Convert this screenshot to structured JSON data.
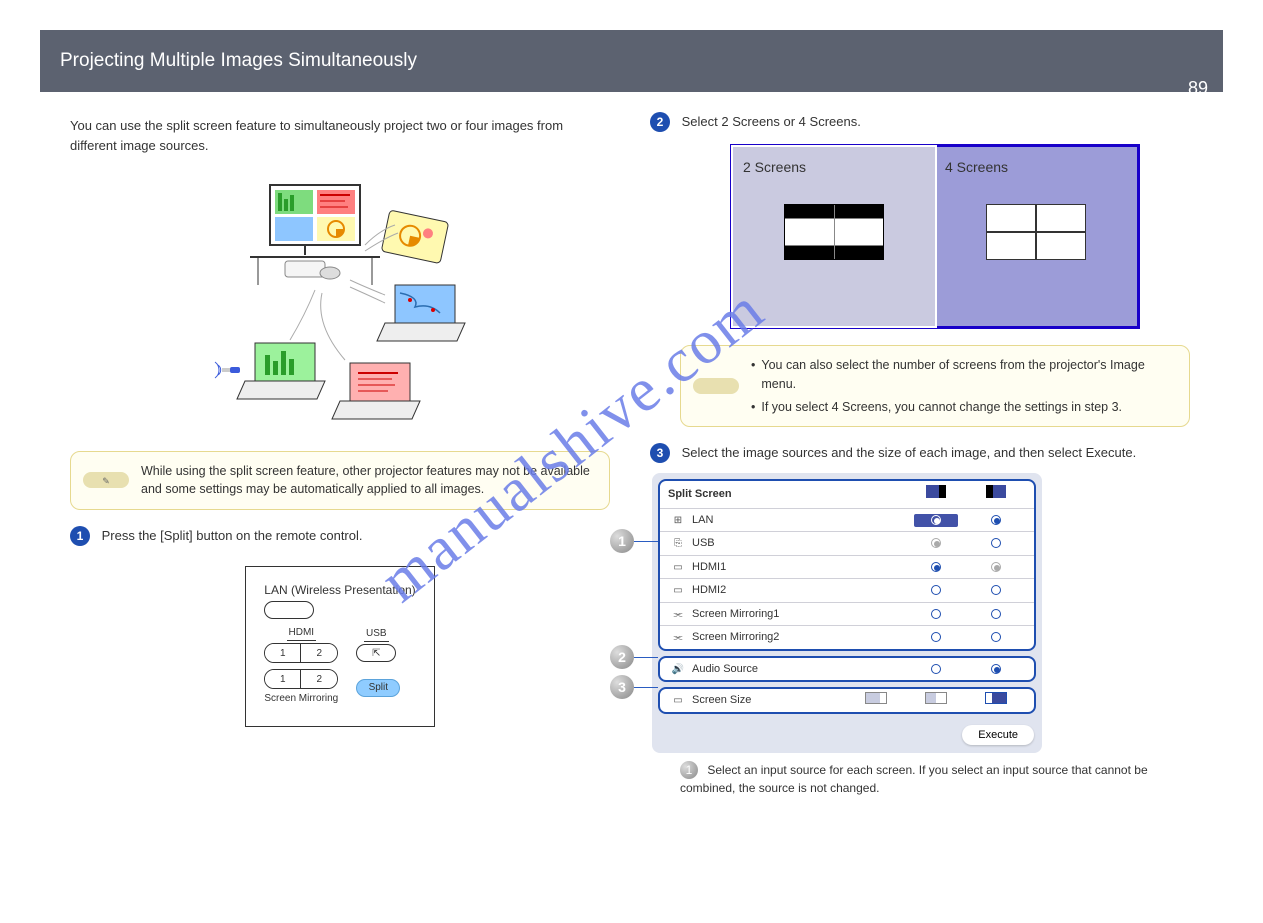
{
  "header": {
    "title": "Projecting Multiple Images Simultaneously",
    "page": "89"
  },
  "left": {
    "intro": "You can use the split screen feature to simultaneously project two or four images from different image sources.",
    "note_text": "While using the split screen feature, other projector features may not be available and some settings may be automatically applied to all images.",
    "step1": "Press the [Split] button on the remote control.",
    "remote": {
      "lan": "LAN (Wireless Presentation)",
      "hdmi": "HDMI",
      "usb": "USB",
      "b1": "1",
      "b2": "2",
      "sm": "Screen Mirroring",
      "split": "Split"
    }
  },
  "right": {
    "step2": "Select 2 Screens or 4 Screens.",
    "opt2": "2 Screens",
    "opt4": "4 Screens",
    "note2a": "You can also select the number of screens from the projector's Image menu.",
    "note2b": "If you select 4 Screens, you cannot change the settings in step 3.",
    "step3": "Select the image sources and the size of each image, and then select Execute.",
    "menu": {
      "head": "Split Screen",
      "rows": [
        {
          "icon": "lan",
          "label": "LAN",
          "a": "sel-on",
          "b": "on"
        },
        {
          "icon": "usb",
          "label": "USB",
          "a": "grey-on",
          "b": "off"
        },
        {
          "icon": "hdmi",
          "label": "HDMI1",
          "a": "on",
          "b": "grey-on"
        },
        {
          "icon": "hdmi",
          "label": "HDMI2",
          "a": "off",
          "b": "off"
        },
        {
          "icon": "mirr",
          "label": "Screen Mirroring1",
          "a": "off",
          "b": "off"
        },
        {
          "icon": "mirr",
          "label": "Screen Mirroring2",
          "a": "off",
          "b": "off"
        }
      ],
      "audio": "Audio Source",
      "size": "Screen Size",
      "execute": "Execute"
    },
    "callout_note": "Select an input source for each screen. If you select an input source that cannot be combined, the source is not changed."
  },
  "watermark": "manualshive.com"
}
